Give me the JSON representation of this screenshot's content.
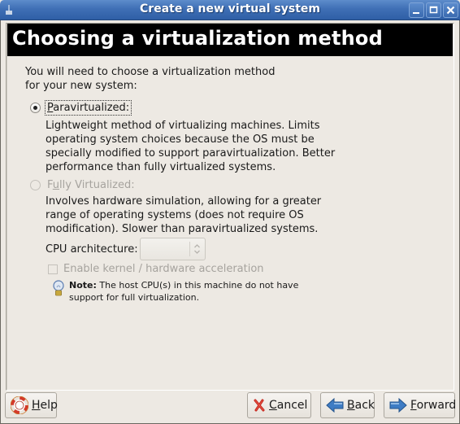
{
  "window": {
    "title": "Create a new virtual system",
    "controls": [
      "minimize",
      "maximize",
      "close"
    ]
  },
  "header": {
    "title": "Choosing a virtualization method"
  },
  "intro": {
    "line1": "You will need to choose a virtualization method",
    "line2": "for your new system:"
  },
  "options": [
    {
      "label_mnemonic": "P",
      "label_rest": "aravirtualized:",
      "selected": true,
      "enabled": true,
      "description": [
        "Lightweight method of virtualizing machines. Limits",
        "operating system choices because the OS must be",
        "specially modified to support paravirtualization. Better",
        "performance than fully virtualized systems."
      ]
    },
    {
      "label_prefix": "F",
      "label_mnemonic": "u",
      "label_rest": "lly Virtualized:",
      "selected": false,
      "enabled": false,
      "description": [
        "Involves hardware simulation, allowing for a greater",
        "range of operating systems (does not require OS",
        "modification). Slower than paravirtualized systems."
      ]
    }
  ],
  "cpu_architecture": {
    "label": "CPU architecture:",
    "value": ""
  },
  "acceleration": {
    "label": "Enable kernel / hardware acceleration",
    "checked": false,
    "enabled": false
  },
  "note": {
    "bold": "Note:",
    "text1": " The host CPU(s) in this machine do not have",
    "text2": "support for full virtualization.",
    "icon": "lightbulb-icon"
  },
  "buttons": {
    "help": {
      "mnemonic": "H",
      "rest": "elp",
      "icon": "lifebuoy-icon"
    },
    "cancel": {
      "mnemonic": "C",
      "rest": "ancel",
      "icon": "red-x-icon"
    },
    "back": {
      "mnemonic": "B",
      "rest": "ack",
      "icon": "left-arrow-icon"
    },
    "forward": {
      "mnemonic": "F",
      "rest": "orward",
      "icon": "right-arrow-icon"
    }
  },
  "colors": {
    "titlebar": "#3f6fb5",
    "banner": "#000000",
    "background": "#ede9e3",
    "disabled_text": "#a6a39e"
  }
}
